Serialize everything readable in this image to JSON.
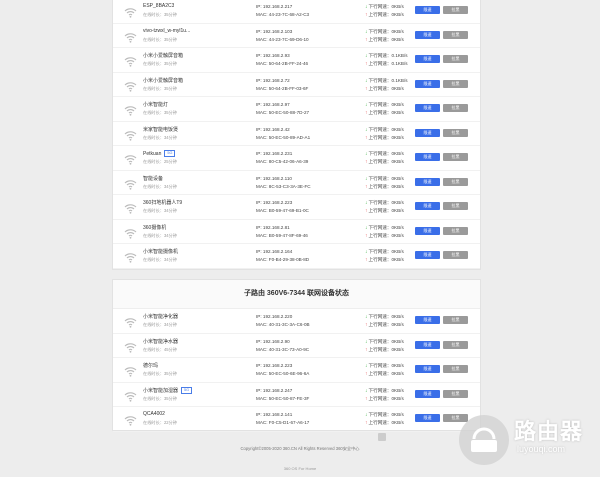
{
  "sub_title": "子路由 360V6-7344 联网设备状态",
  "labels": {
    "down": "下行网速：",
    "up": "上行网速：",
    "limit": "限速",
    "block": "拉黑"
  },
  "colors": {
    "limit": "#3a6ee8",
    "block": "#9a9a9a",
    "down_arrow": "#3cb043",
    "up_arrow": "#e34b4b"
  },
  "main_devices": [
    {
      "name": "ESP_8BA2C3",
      "time": "在线时长：35分钟",
      "ip": "IP: 192.168.2.217",
      "mac": "MAC: 44-23-7C-68-A2-C3",
      "down": "0KB/s",
      "up": "0KB/s"
    },
    {
      "name": "vivo-tzwxl_w-myl1u...",
      "time": "在线时长：35分钟",
      "ip": "IP: 192.168.2.103",
      "mac": "MAC: 44-23-7C-69-D6-10",
      "down": "0KB/s",
      "up": "0KB/s"
    },
    {
      "name": "小米小爱触屏音箱",
      "time": "在线时长：35分钟",
      "ip": "IP: 192.168.2.93",
      "mac": "MAC: 50-64-2B-FF-24-46",
      "down": "0.1KB/s",
      "up": "0.1KB/s"
    },
    {
      "name": "小米小爱触屏音箱",
      "time": "在线时长：35分钟",
      "ip": "IP: 192.168.2.72",
      "mac": "MAC: 50-64-2B-FF-03-6F",
      "down": "0.1KB/s",
      "up": "0KB/s"
    },
    {
      "name": "小米智能灯",
      "time": "在线时长：35分钟",
      "ip": "IP: 192.168.2.97",
      "mac": "MAC: 50-EC-50-88-7D-27",
      "down": "0KB/s",
      "up": "0KB/s"
    },
    {
      "name": "米家智能电饭煲",
      "time": "在线时长：34分钟",
      "ip": "IP: 192.168.2.42",
      "mac": "MAC: 50-EC-50-89-AD-A1",
      "down": "0KB/s",
      "up": "0KB/s"
    },
    {
      "name": "Petkuan",
      "badge": "5G",
      "time": "在线时长：25分钟",
      "ip": "IP: 192.168.2.231",
      "mac": "MAC: 80-C5-42-06-A6-39",
      "down": "0KB/s",
      "up": "0KB/s"
    },
    {
      "name": "智能设备",
      "time": "在线时长：34分钟",
      "ip": "IP: 192.168.2.110",
      "mac": "MAC: 8C-53-C3-3A-3E-FC",
      "down": "0KB/s",
      "up": "0KB/s"
    },
    {
      "name": "360扫地机器人T9",
      "time": "在线时长：34分钟",
      "ip": "IP: 192.168.2.223",
      "mac": "MAC: B0-59-47-69-B1-0C",
      "down": "0KB/s",
      "up": "0KB/s"
    },
    {
      "name": "360摄像机",
      "time": "在线时长：34分钟",
      "ip": "IP: 192.168.2.81",
      "mac": "MAC: B0-59-47-8F-69-46",
      "down": "0KB/s",
      "up": "0KB/s"
    },
    {
      "name": "小米智能摄像机",
      "time": "在线时长：34分钟",
      "ip": "IP: 192.168.2.164",
      "mac": "MAC: F0-B4-29-38-0B-8D",
      "down": "0KB/s",
      "up": "0KB/s"
    }
  ],
  "sub_devices": [
    {
      "name": "小米智能净化器",
      "time": "在线时长：34分钟",
      "ip": "IP: 192.168.2.220",
      "mac": "MAC: 40-31-3C-3A-C6-0B",
      "down": "0KB/s",
      "up": "0KB/s"
    },
    {
      "name": "小米智能净水器",
      "time": "在线时长：45分钟",
      "ip": "IP: 192.168.2.90",
      "mac": "MAC: 40-31-3C-73-A0-9C",
      "down": "0KB/s",
      "up": "0KB/s"
    },
    {
      "name": "德尔玛",
      "time": "在线时长：35分钟",
      "ip": "IP: 192.168.2.223",
      "mac": "MAC: 50-EC-50-6E-96-6A",
      "down": "0KB/s",
      "up": "0KB/s"
    },
    {
      "name": "小米智能加湿器",
      "badge": "5G",
      "time": "在线时长：35分钟",
      "ip": "IP: 192.168.2.247",
      "mac": "MAC: 50-EC-50-87-FE-3F",
      "down": "0KB/s",
      "up": "0KB/s"
    },
    {
      "name": "QCA4002",
      "time": "在线时长：22分钟",
      "ip": "IP: 192.168.2.141",
      "mac": "MAC: F0-C5-D1-67-A6-17",
      "down": "0KB/s",
      "up": "0KB/s"
    }
  ],
  "footer": "Copyright©2005-2020 360.CN All Rights Reserved 360安全中心",
  "footer2": "360 OS For Home",
  "watermark": {
    "title": "路由器",
    "sub": "luyouqi.com",
    "icon": "router-logo-icon"
  }
}
